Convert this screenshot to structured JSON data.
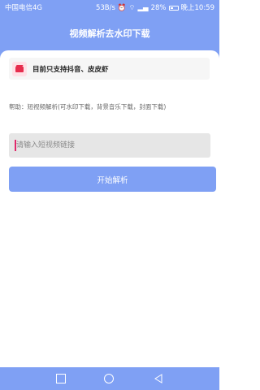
{
  "status_bar": {
    "carrier": "中国电信4G",
    "speed": "53B/s",
    "battery": "28%",
    "time": "晚上10:59"
  },
  "app": {
    "title": "视频解析去水印下载"
  },
  "notice": {
    "text": "目前只支持抖音、皮皮虾",
    "icon": "video-clapper-icon"
  },
  "help": {
    "text": "帮助：短视频解析(可水印下载，背景音乐下载，封面下载)"
  },
  "input": {
    "placeholder": "请输入短视频链接",
    "value": ""
  },
  "button": {
    "label": "开始解析"
  },
  "nav": {
    "items": [
      "recent-apps-icon",
      "home-icon",
      "back-icon"
    ]
  },
  "colors": {
    "primary": "#7fa0f4",
    "input_bg": "#e6e6e6",
    "notice_bg": "#f6f6f6",
    "icon_accent": "#e62e4e"
  }
}
